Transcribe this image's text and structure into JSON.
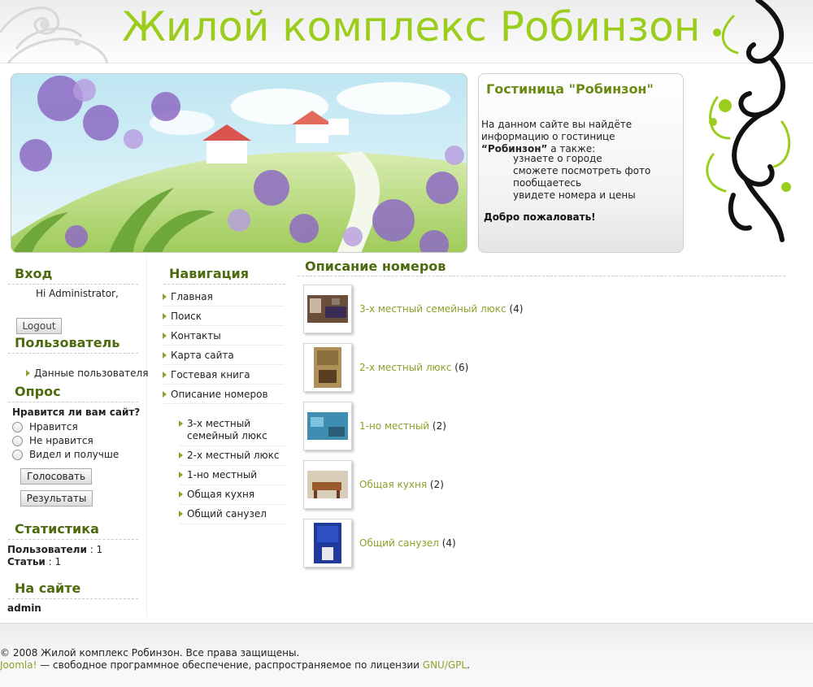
{
  "site": {
    "title": "Жилой комплекс Робинзон"
  },
  "infobox": {
    "title": "Гостиница \"Робинзон\"",
    "intro_1": "На данном сайте вы найдёте информацию о гостинице ",
    "intro_bold": "“Робинзон”",
    "intro_2": " а также:",
    "items": [
      "узнаете о городе",
      "сможете посмотреть фото",
      "пообщаетесь",
      "увидете номера и цены"
    ],
    "welcome": "Добро пожаловать!"
  },
  "login": {
    "title": "Вход",
    "greeting": "Hi Administrator,",
    "logout": "Logout"
  },
  "user": {
    "title": "Пользователь",
    "link": "Данные пользователя"
  },
  "poll": {
    "title": "Опрос",
    "question": "Нравится ли вам сайт?",
    "options": [
      "Нравится",
      "Не нравится",
      "Видел и получше"
    ],
    "vote": "Голосовать",
    "results": "Результаты"
  },
  "stats": {
    "title": "Статистика",
    "users_label": "Пользователи",
    "users_value": " : 1",
    "articles_label": "Статьи",
    "articles_value": " : 1"
  },
  "online": {
    "title": "На сайте",
    "user": "admin"
  },
  "nav": {
    "title": "Навигация",
    "items": [
      "Главная",
      "Поиск",
      "Контакты",
      "Карта сайта",
      "Гостевая книга",
      "Описание номеров"
    ],
    "subitems": [
      "3-х местный семейный люкс",
      "2-х местный люкс",
      "1-но местный",
      "Общая кухня",
      "Общий санузел"
    ]
  },
  "main": {
    "title": "Описание номеров",
    "categories": [
      {
        "name": "3-х местный семейный люкс",
        "count": " (4)"
      },
      {
        "name": "2-х местный люкс",
        "count": " (6)"
      },
      {
        "name": "1-но местный",
        "count": " (2)"
      },
      {
        "name": "Общая кухня",
        "count": " (2)"
      },
      {
        "name": "Общий санузел",
        "count": " (4)"
      }
    ]
  },
  "footer": {
    "copyright": "© 2008 Жилой комплекс Робинзон. Все права защищены.",
    "joomla": "Joomla!",
    "license_text": " — свободное программное обеспечение, распространяемое по лицензии ",
    "gpl": "GNU/GPL",
    "dot": "."
  }
}
